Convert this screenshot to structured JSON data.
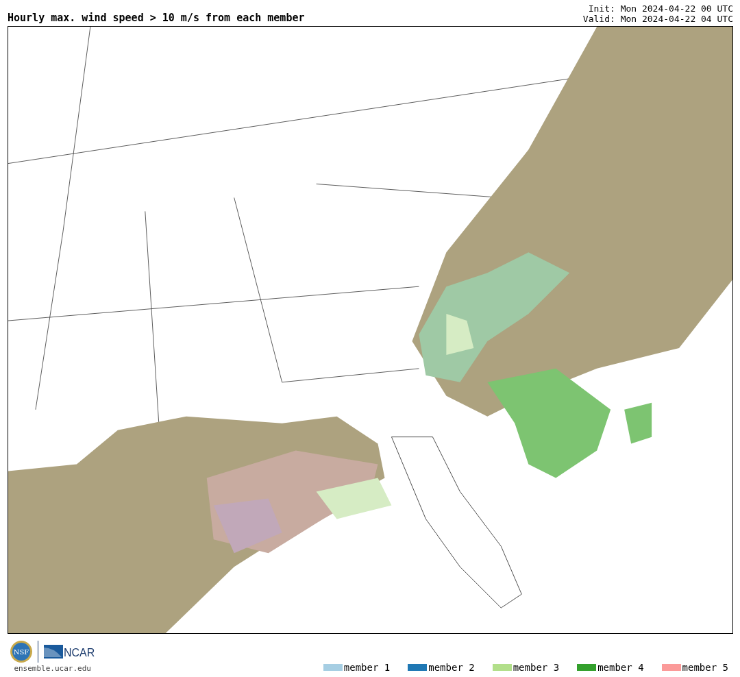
{
  "header": {
    "title": "Hourly max. wind speed > 10 m/s from each member",
    "init": "Init: Mon 2024-04-22 00 UTC",
    "valid": "Valid: Mon 2024-04-22 04 UTC"
  },
  "footer": {
    "nsf_logo": "NSF",
    "ncar_logo": "NCAR",
    "url": "ensemble.ucar.edu"
  },
  "legend": [
    {
      "label": "member 1",
      "color": "#a6cee3"
    },
    {
      "label": "member 2",
      "color": "#1f78b4"
    },
    {
      "label": "member 3",
      "color": "#b2df8a"
    },
    {
      "label": "member 4",
      "color": "#33a02c"
    },
    {
      "label": "member 5",
      "color": "#fb9a99"
    }
  ]
}
